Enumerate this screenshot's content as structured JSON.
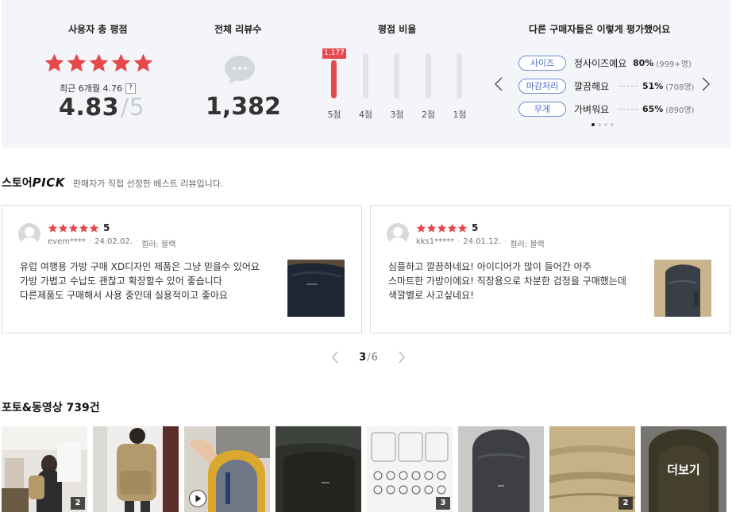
{
  "summary": {
    "total_rating_title": "사용자 총 평점",
    "recent_label": "최근 6개월 4.76",
    "help_icon_text": "?",
    "average": "4.83",
    "average_max": "/5",
    "star_count": 5,
    "review_count_title": "전체 리뷰수",
    "review_count": "1,382",
    "ratio_title": "평점 비율",
    "ratio_badge": "1,177",
    "ratio_bars": [
      {
        "label": "5점",
        "fraction": 0.85
      },
      {
        "label": "4점",
        "fraction": 0.0
      },
      {
        "label": "3점",
        "fraction": 0.0
      },
      {
        "label": "2점",
        "fraction": 0.0
      },
      {
        "label": "1점",
        "fraction": 0.0
      }
    ],
    "others_title": "다른 구매자들은 이렇게 평가했어요",
    "attributes": [
      {
        "tag": "사이즈",
        "value": "정사이즈예요",
        "percent": "80%",
        "count": "(999+명)"
      },
      {
        "tag": "마감처리",
        "value": "깔끔해요",
        "percent": "51%",
        "count": "(708명)"
      },
      {
        "tag": "무게",
        "value": "가벼워요",
        "percent": "65%",
        "count": "(890명)"
      }
    ],
    "accent_color": "#e5484d",
    "tag_color": "#4a6bd1"
  },
  "store_pick": {
    "title_prefix": "스토어",
    "title_pick": "PICK",
    "description": "판매자가 직접 선정한 베스트 리뷰입니다.",
    "reviews": [
      {
        "score": "5",
        "user": "evem****",
        "date": "24.02.02.",
        "option": "컬러: 블랙",
        "lines": [
          "유럽 여행용 가방 구매 XD디자인 제품은 그냥 믿을수 있어요",
          "가방 가볍고 수납도 괜찮고 확장할수 있어 좋습니다",
          "다른제품도 구매해서 사용 중인데 실용적이고 좋아요"
        ]
      },
      {
        "score": "5",
        "user": "kks1*****",
        "date": "24.01.12.",
        "option": "컬러: 블랙",
        "lines": [
          "심플하고 깔끔하네요! 아이디어가 많이 들어간 아주",
          "스마트한 가방이에요! 직장용으로 차분한 검정을 구매했는데",
          "색깔별로 사고싶네요!"
        ]
      }
    ],
    "pager": {
      "current": "3",
      "separator": "/",
      "total": "6"
    }
  },
  "photos": {
    "title": "포토&동영상 739건",
    "items": [
      {
        "count": "2"
      },
      {
        "count": ""
      },
      {
        "count": ""
      },
      {
        "count": ""
      },
      {
        "count": "3"
      },
      {
        "count": ""
      },
      {
        "count": "2"
      },
      {
        "count": ""
      }
    ],
    "more_label": "더보기"
  }
}
